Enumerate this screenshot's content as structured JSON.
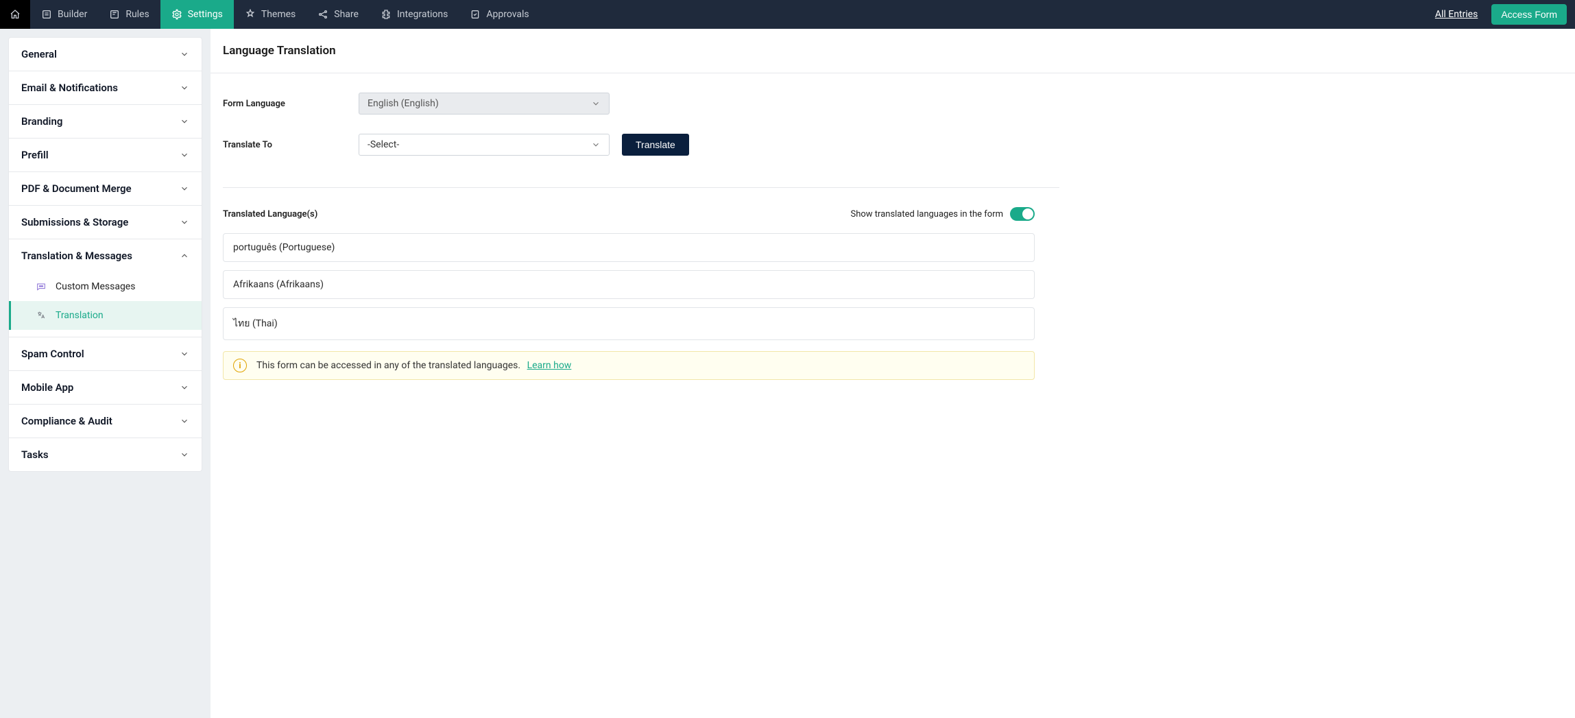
{
  "topnav": {
    "tabs": [
      {
        "label": "Builder"
      },
      {
        "label": "Rules"
      },
      {
        "label": "Settings"
      },
      {
        "label": "Themes"
      },
      {
        "label": "Share"
      },
      {
        "label": "Integrations"
      },
      {
        "label": "Approvals"
      }
    ],
    "all_entries": "All Entries",
    "access_form": "Access Form"
  },
  "sidebar": {
    "sections": [
      {
        "label": "General",
        "expanded": false
      },
      {
        "label": "Email & Notifications",
        "expanded": false
      },
      {
        "label": "Branding",
        "expanded": false
      },
      {
        "label": "Prefill",
        "expanded": false
      },
      {
        "label": "PDF & Document Merge",
        "expanded": false
      },
      {
        "label": "Submissions & Storage",
        "expanded": false
      },
      {
        "label": "Translation & Messages",
        "expanded": true,
        "items": [
          {
            "label": "Custom Messages"
          },
          {
            "label": "Translation",
            "active": true
          }
        ]
      },
      {
        "label": "Spam Control",
        "expanded": false
      },
      {
        "label": "Mobile App",
        "expanded": false
      },
      {
        "label": "Compliance & Audit",
        "expanded": false
      },
      {
        "label": "Tasks",
        "expanded": false
      }
    ]
  },
  "main": {
    "title": "Language Translation",
    "form_language_label": "Form Language",
    "form_language_value": "English (English)",
    "translate_to_label": "Translate To",
    "translate_to_value": "-Select-",
    "translate_btn": "Translate",
    "translated_header": "Translated Language(s)",
    "show_toggle_label": "Show translated languages in the form",
    "languages": [
      "português (Portuguese)",
      "Afrikaans (Afrikaans)",
      "ไทย (Thai)"
    ],
    "info_text": "This form can be accessed in any of the translated languages.",
    "info_link": "Learn how"
  }
}
